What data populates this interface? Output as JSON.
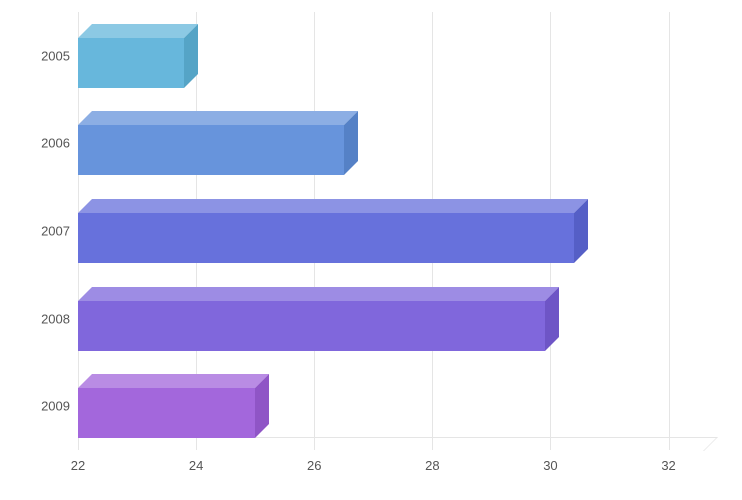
{
  "chart_data": {
    "type": "bar",
    "orientation": "horizontal",
    "categories": [
      "2005",
      "2006",
      "2007",
      "2008",
      "2009"
    ],
    "values": [
      23.8,
      26.5,
      30.4,
      29.9,
      25.0
    ],
    "xticks": [
      22,
      24,
      26,
      28,
      30,
      32
    ],
    "xlim": [
      22,
      32.6
    ],
    "title": "",
    "xlabel": "",
    "ylabel": "",
    "colors": {
      "2005": {
        "front": "#67b7dc",
        "top": "#8cc9e4",
        "side": "#55a4c6"
      },
      "2006": {
        "front": "#6794dc",
        "top": "#8caee4",
        "side": "#5581c6"
      },
      "2007": {
        "front": "#6771dc",
        "top": "#8c93e4",
        "side": "#555fc6"
      },
      "2008": {
        "front": "#8067dc",
        "top": "#9d8ce4",
        "side": "#6e55c6"
      },
      "2009": {
        "front": "#a367dc",
        "top": "#b98ce4",
        "side": "#8f55c6"
      }
    }
  }
}
